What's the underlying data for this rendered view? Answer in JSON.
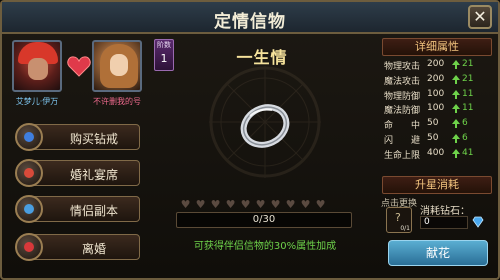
{
  "window": {
    "title": "定情信物",
    "close_glyph": "✕"
  },
  "couple": {
    "player1_name": "艾梦儿·伊万",
    "player2_name": "不许删我的号"
  },
  "menu": [
    {
      "label": "购买钻戒",
      "icon": "diamond-ring-icon",
      "icon_color": "#3f7fe0"
    },
    {
      "label": "婚礼宴席",
      "icon": "banquet-icon",
      "icon_color": "#d84a3a"
    },
    {
      "label": "情侣副本",
      "icon": "dungeon-icon",
      "icon_color": "#4a9ee0"
    },
    {
      "label": "离婚",
      "icon": "broken-heart-icon",
      "icon_color": "#d8383a"
    }
  ],
  "token": {
    "rank_label": "阶数",
    "rank_value": "1",
    "name": "一生情",
    "hearts_total": 10,
    "hearts_filled": 0,
    "progress_text": "0/30",
    "progress_value": 0,
    "progress_max": 30,
    "bonus_note": "可获得伴侣信物的30%属性加成"
  },
  "attributes": {
    "heading": "详细属性",
    "rows": [
      {
        "name": "物理攻击",
        "value": "200",
        "inc": "21"
      },
      {
        "name": "魔法攻击",
        "value": "200",
        "inc": "21"
      },
      {
        "name": "物理防御",
        "value": "100",
        "inc": "11"
      },
      {
        "name": "魔法防御",
        "value": "100",
        "inc": "11"
      },
      {
        "name": "命　　中",
        "value": "50",
        "inc": "6"
      },
      {
        "name": "闪　　避",
        "value": "50",
        "inc": "6"
      },
      {
        "name": "生命上限",
        "value": "400",
        "inc": "41"
      }
    ]
  },
  "upgrade": {
    "heading": "升星消耗",
    "replace_label": "点击更换",
    "slot_count": "0/1",
    "cost_label": "消耗钻石：",
    "cost_value": "0",
    "action_label": "献花"
  },
  "colors": {
    "increase": "#6ed24a",
    "title_gold": "#f6e39c",
    "accent_button": "#3a8ebc"
  }
}
